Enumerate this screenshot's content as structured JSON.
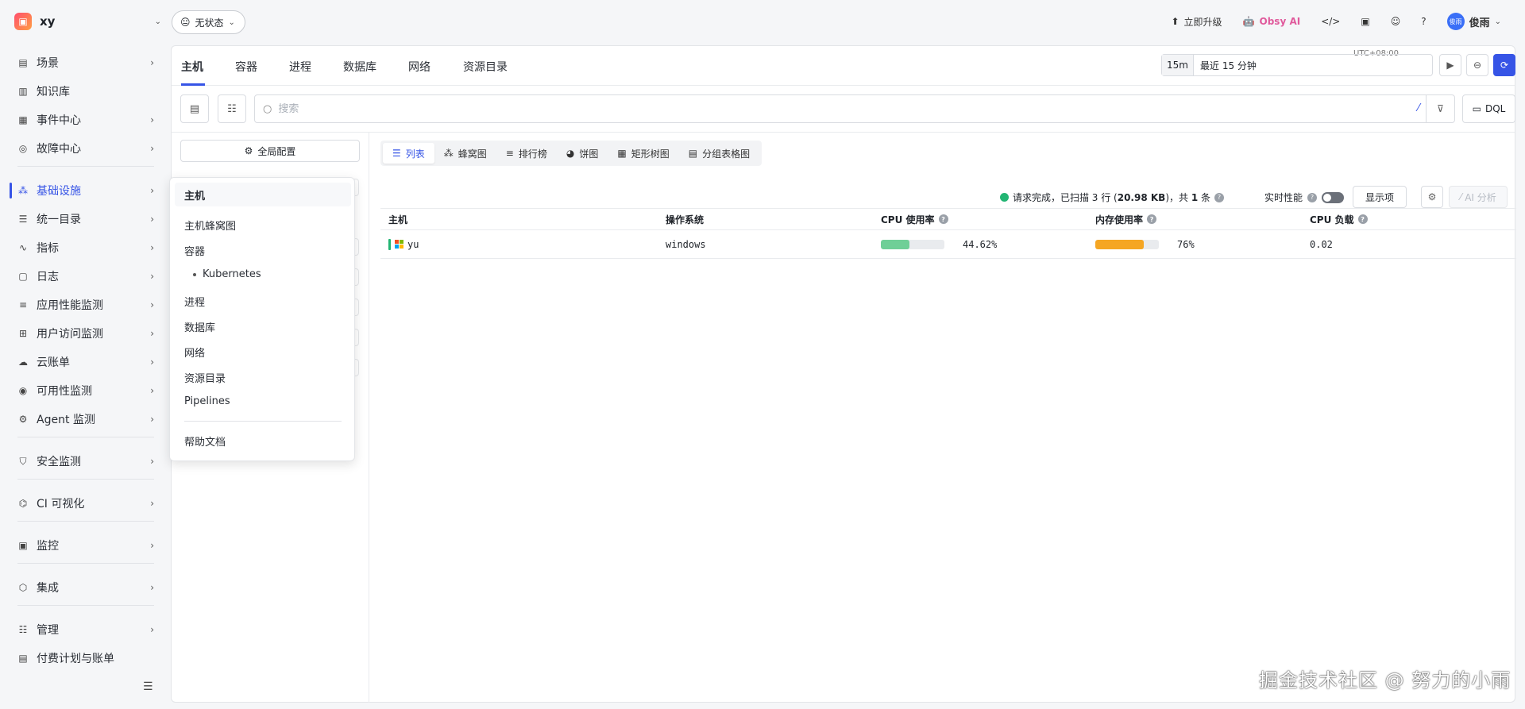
{
  "workspace": {
    "name": "xy"
  },
  "status": {
    "emoji": "😐",
    "label": "无状态"
  },
  "topnav": {
    "upgrade": "立即升级",
    "obsy": "Obsy AI",
    "user_avatar": "俊雨",
    "user_name": "俊雨"
  },
  "sidebar": {
    "items": [
      {
        "label": "场景",
        "icon": "scene-icon"
      },
      {
        "label": "知识库",
        "icon": "book-icon"
      },
      {
        "label": "事件中心",
        "icon": "calendar-icon"
      },
      {
        "label": "故障中心",
        "icon": "fault-icon"
      },
      {
        "label": "基础设施",
        "icon": "infra-icon"
      },
      {
        "label": "统一目录",
        "icon": "catalog-icon"
      },
      {
        "label": "指标",
        "icon": "metric-icon"
      },
      {
        "label": "日志",
        "icon": "log-icon"
      },
      {
        "label": "应用性能监测",
        "icon": "apm-icon"
      },
      {
        "label": "用户访问监测",
        "icon": "rum-icon"
      },
      {
        "label": "云账单",
        "icon": "cloud-bill-icon"
      },
      {
        "label": "可用性监测",
        "icon": "availability-icon"
      },
      {
        "label": "Agent 监测",
        "icon": "agent-icon"
      },
      {
        "label": "安全监测",
        "icon": "shield-icon"
      },
      {
        "label": "CI 可视化",
        "icon": "ci-icon"
      },
      {
        "label": "监控",
        "icon": "monitor-icon"
      },
      {
        "label": "集成",
        "icon": "integration-icon"
      },
      {
        "label": "管理",
        "icon": "manage-icon"
      },
      {
        "label": "付费计划与账单",
        "icon": "billing-icon"
      }
    ]
  },
  "tabs": [
    "主机",
    "容器",
    "进程",
    "数据库",
    "网络",
    "资源目录"
  ],
  "time": {
    "timezone": "UTC+08:00",
    "short": "15m",
    "long": "最近 15 分钟"
  },
  "search": {
    "placeholder": "搜索"
  },
  "dql": "DQL",
  "global_config": "全局配置",
  "viz_tabs": [
    "列表",
    "蜂窝图",
    "排行榜",
    "饼图",
    "矩形树图",
    "分组表格图"
  ],
  "scan": {
    "prefix": "请求完成，已扫描 3 行 (",
    "size": "20.98 KB",
    "mid": ")，共 ",
    "count": "1",
    "suffix": " 条"
  },
  "realtime": "实时性能",
  "display_btn": "显示项",
  "ai_btn": "AI 分析",
  "table": {
    "headers": [
      "主机",
      "操作系统",
      "CPU 使用率",
      "内存使用率",
      "CPU 负载"
    ],
    "rows": [
      {
        "host": "yu",
        "os": "windows",
        "cpu": "44.62%",
        "cpu_fraction": 0.4462,
        "mem": "76%",
        "mem_fraction": 0.76,
        "load": "0.02"
      }
    ]
  },
  "menu": {
    "items": [
      "主机",
      "主机蜂窝图",
      "容器",
      "Kubernetes",
      "进程",
      "数据库",
      "网络",
      "资源目录",
      "Pipelines"
    ],
    "help": "帮助文档"
  },
  "watermark": "掘金技术社区 @ 努力的小雨",
  "colors": {
    "accent": "#3654e6",
    "cpu_bar": "#6fcf97",
    "mem_bar": "#f5a623",
    "ok": "#22b573"
  }
}
